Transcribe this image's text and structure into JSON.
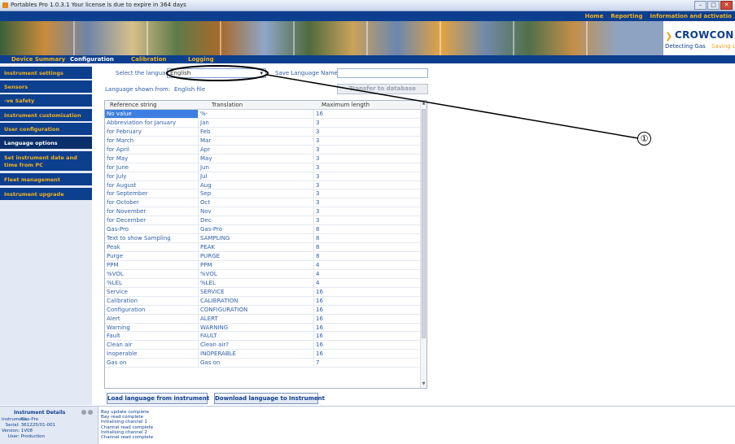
{
  "window": {
    "title": "Portables Pro 1.0.3.1   Your license is due to expire in 364 days",
    "controls": [
      "–",
      "□",
      "✕"
    ]
  },
  "top_nav": [
    "Home",
    "Reporting",
    "Information and activatio"
  ],
  "brand": {
    "name": "CROWCON",
    "tagline_a": "Detecting Gas",
    "tagline_b": "Saving Live"
  },
  "tabs": [
    "Device Summary",
    "Configuration",
    "Calibration",
    "Logging"
  ],
  "active_tab": "Configuration",
  "sidebar": [
    "Instrument settings",
    "Sensors",
    "-ve Safety",
    "Instrument customisation",
    "User configuration",
    "Language options",
    "Set instrument date and time from PC",
    "Fleet management",
    "Instrument upgrade"
  ],
  "active_sidebar": "Language options",
  "language": {
    "select_label": "Select the language",
    "selected": "English",
    "save_name_label": "Save Language Name",
    "shown_from_label": "Language shown from:",
    "shown_from_value": "English file",
    "transfer_button": "Transfer to database"
  },
  "table": {
    "columns": [
      "Reference string",
      "Translation",
      "Maximum length"
    ],
    "rows": [
      [
        "No value",
        "%-",
        "16"
      ],
      [
        "Abbreviation for January",
        "Jan",
        "3"
      ],
      [
        "for February",
        "Feb",
        "3"
      ],
      [
        "for March",
        "Mar",
        "3"
      ],
      [
        "for April",
        "Apr",
        "3"
      ],
      [
        "for May",
        "May",
        "3"
      ],
      [
        "for June",
        "Jun",
        "3"
      ],
      [
        "for July",
        "Jul",
        "3"
      ],
      [
        "for August",
        "Aug",
        "3"
      ],
      [
        "for September",
        "Sep",
        "3"
      ],
      [
        "for October",
        "Oct",
        "3"
      ],
      [
        "for November",
        "Nov",
        "3"
      ],
      [
        "for December",
        "Dec",
        "3"
      ],
      [
        "Gas-Pro",
        "Gas-Pro",
        "8"
      ],
      [
        "Text to show Sampling",
        "SAMPLING",
        "8"
      ],
      [
        "Peak",
        "PEAK",
        "8"
      ],
      [
        "Purge",
        "PURGE",
        "8"
      ],
      [
        "PPM",
        "PPM",
        "4"
      ],
      [
        "%VOL",
        "%VOL",
        "4"
      ],
      [
        "%LEL",
        "%LEL",
        "4"
      ],
      [
        "Service",
        "SERVICE",
        "16"
      ],
      [
        "Calibration",
        "CALIBRATION",
        "16"
      ],
      [
        "Configuration",
        "CONFIGURATION",
        "16"
      ],
      [
        "Alert",
        "ALERT",
        "16"
      ],
      [
        "Warning",
        "WARNING",
        "16"
      ],
      [
        "Fault",
        "FAULT",
        "16"
      ],
      [
        "Clean air",
        "Clean air?",
        "16"
      ],
      [
        "Inoperable",
        "INOPERABLE",
        "16"
      ],
      [
        "Gas on",
        "Gas on",
        "7"
      ]
    ],
    "selected_row": 0
  },
  "buttons": {
    "load": "Load language from instrument",
    "download": "Download language to Instrument"
  },
  "instrument_details": {
    "header": "Instrument Details",
    "fields": [
      {
        "key": "Instrument:",
        "value": "Gas-Pro"
      },
      {
        "key": "Serial:",
        "value": "361225/01-001"
      },
      {
        "key": "Version:",
        "value": "1V08"
      },
      {
        "key": "User:",
        "value": "Production"
      }
    ]
  },
  "log": [
    "Bay update complete",
    "Bay read complete",
    "Initialising channel 1",
    "Channel read complete",
    "Initialising channel 2",
    "Channel read complete"
  ],
  "callout": "①"
}
